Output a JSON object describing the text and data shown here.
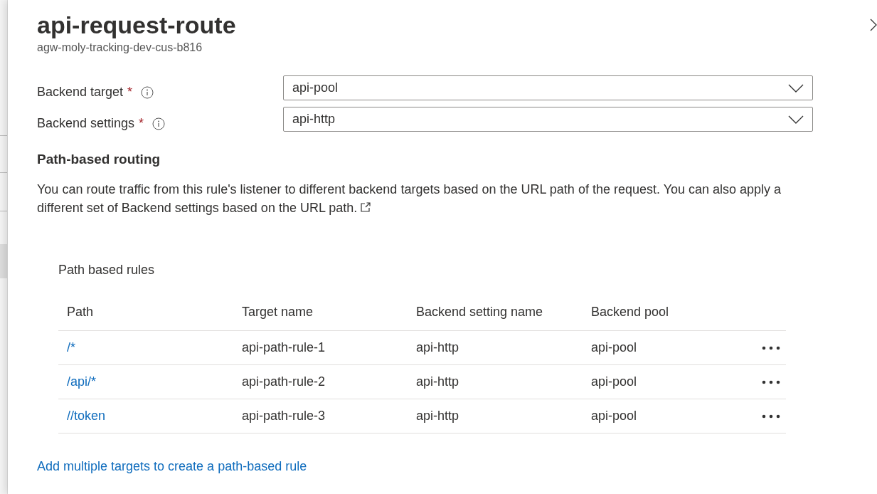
{
  "panel": {
    "title": "api-request-route",
    "subtitle": "agw-moly-tracking-dev-cus-b816"
  },
  "fields": [
    {
      "label": "Backend target",
      "required_mark": "*",
      "value": "api-pool"
    },
    {
      "label": "Backend settings",
      "required_mark": "*",
      "value": "api-http"
    }
  ],
  "section": {
    "heading": "Path-based routing",
    "description": "You can route traffic from this rule's listener to different backend targets based on the URL path of the request. You can also apply a different set of Backend settings based on the URL path."
  },
  "rules": {
    "caption": "Path based rules",
    "columns": [
      "Path",
      "Target name",
      "Backend setting name",
      "Backend pool"
    ],
    "rows": [
      {
        "path": "/*",
        "target_name": "api-path-rule-1",
        "backend_setting_name": "api-http",
        "backend_pool": "api-pool"
      },
      {
        "path": "/api/*",
        "target_name": "api-path-rule-2",
        "backend_setting_name": "api-http",
        "backend_pool": "api-pool"
      },
      {
        "path": "//token",
        "target_name": "api-path-rule-3",
        "backend_setting_name": "api-http",
        "backend_pool": "api-pool"
      }
    ]
  },
  "add_link": "Add multiple targets to create a path-based rule"
}
